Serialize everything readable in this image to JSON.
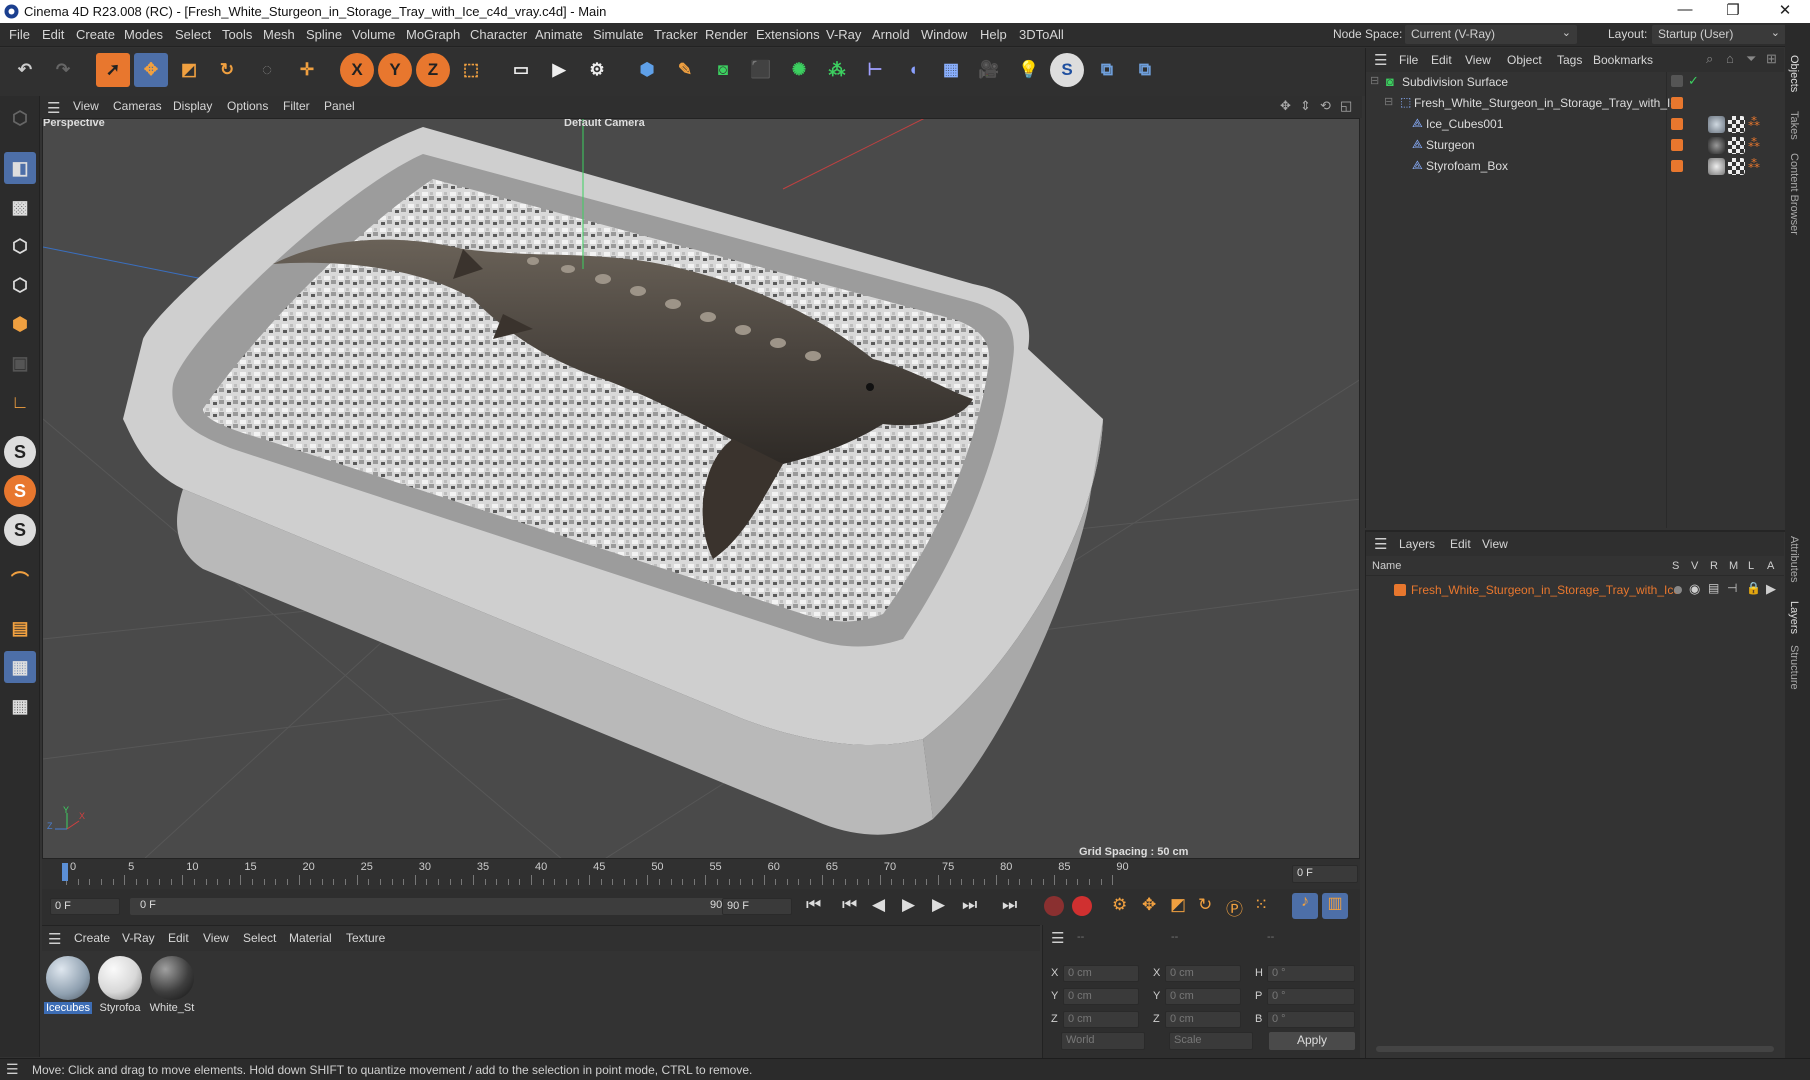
{
  "window": {
    "title": "Cinema 4D R23.008 (RC) - [Fresh_White_Sturgeon_in_Storage_Tray_with_Ice_c4d_vray.c4d] - Main",
    "minimize": "—",
    "maximize": "❐",
    "close": "✕"
  },
  "menu": [
    "File",
    "Edit",
    "Create",
    "Modes",
    "Select",
    "Tools",
    "Mesh",
    "Spline",
    "Volume",
    "MoGraph",
    "Character",
    "Animate",
    "Simulate",
    "Tracker",
    "Render",
    "Extensions",
    "V-Ray",
    "Arnold",
    "Window",
    "Help",
    "3DToAll"
  ],
  "node_space": {
    "label": "Node Space:",
    "value": "Current (V-Ray)"
  },
  "layout": {
    "label": "Layout:",
    "value": "Startup (User)"
  },
  "viewport": {
    "menu": [
      "View",
      "Cameras",
      "Display",
      "Options",
      "Filter",
      "Panel"
    ],
    "name": "Perspective",
    "camera": "Default Camera",
    "grid_spacing": "Grid Spacing : 50 cm",
    "axis_x": "X",
    "axis_y": "Y",
    "axis_z": "Z"
  },
  "timeline": {
    "ticks": [
      "0",
      "5",
      "10",
      "15",
      "20",
      "25",
      "30",
      "35",
      "40",
      "45",
      "50",
      "55",
      "60",
      "65",
      "70",
      "75",
      "80",
      "85",
      "90"
    ],
    "current_frame": "0 F",
    "start": "0 F",
    "range_start": "0 F",
    "range_end": "90 F",
    "end": "90 F"
  },
  "material_menu": [
    "Create",
    "V-Ray",
    "Edit",
    "View",
    "Select",
    "Material",
    "Texture"
  ],
  "materials": [
    {
      "label": "Icecubes",
      "selected": true,
      "color": "#8fa0b0"
    },
    {
      "label": "Styrofoa",
      "selected": false,
      "color": "#d8d8d8"
    },
    {
      "label": "White_St",
      "selected": false,
      "color": "#3e3e3e"
    }
  ],
  "coords": {
    "header_a": "--",
    "header_b": "--",
    "header_c": "--",
    "rows": [
      {
        "a_label": "X",
        "a_val": "0 cm",
        "b_label": "X",
        "b_val": "0 cm",
        "c_label": "H",
        "c_val": "0 °"
      },
      {
        "a_label": "Y",
        "a_val": "0 cm",
        "b_label": "Y",
        "b_val": "0 cm",
        "c_label": "P",
        "c_val": "0 °"
      },
      {
        "a_label": "Z",
        "a_val": "0 cm",
        "b_label": "Z",
        "b_val": "0 cm",
        "c_label": "B",
        "c_val": "0 °"
      }
    ],
    "world": "World",
    "scale": "Scale",
    "apply": "Apply"
  },
  "object_manager": {
    "menu": [
      "File",
      "Edit",
      "View",
      "Object",
      "Tags",
      "Bookmarks"
    ],
    "objects": [
      {
        "name": "Subdivision Surface",
        "indent": 0
      },
      {
        "name": "Fresh_White_Sturgeon_in_Storage_Tray_with_Ice",
        "indent": 1
      },
      {
        "name": "Ice_Cubes001",
        "indent": 2
      },
      {
        "name": "Sturgeon",
        "indent": 2
      },
      {
        "name": "Styrofoam_Box",
        "indent": 2
      }
    ]
  },
  "layers_manager": {
    "menu": [
      "Layers",
      "Edit",
      "View"
    ],
    "col_name": "Name",
    "cols": [
      "S",
      "V",
      "R",
      "M",
      "L",
      "A"
    ],
    "layer_name": "Fresh_White_Sturgeon_in_Storage_Tray_with_Ice"
  },
  "side_tabs": [
    "Objects",
    "Takes",
    "Content Browser",
    "Attributes",
    "Layers",
    "Structure"
  ],
  "status": "Move: Click and drag to move elements. Hold down SHIFT to quantize movement / add to the selection in point mode, CTRL to remove.",
  "colors": {
    "accent": "#e8772e",
    "selection_blue": "#5b8fd6",
    "layer_orange": "#e8772e"
  }
}
